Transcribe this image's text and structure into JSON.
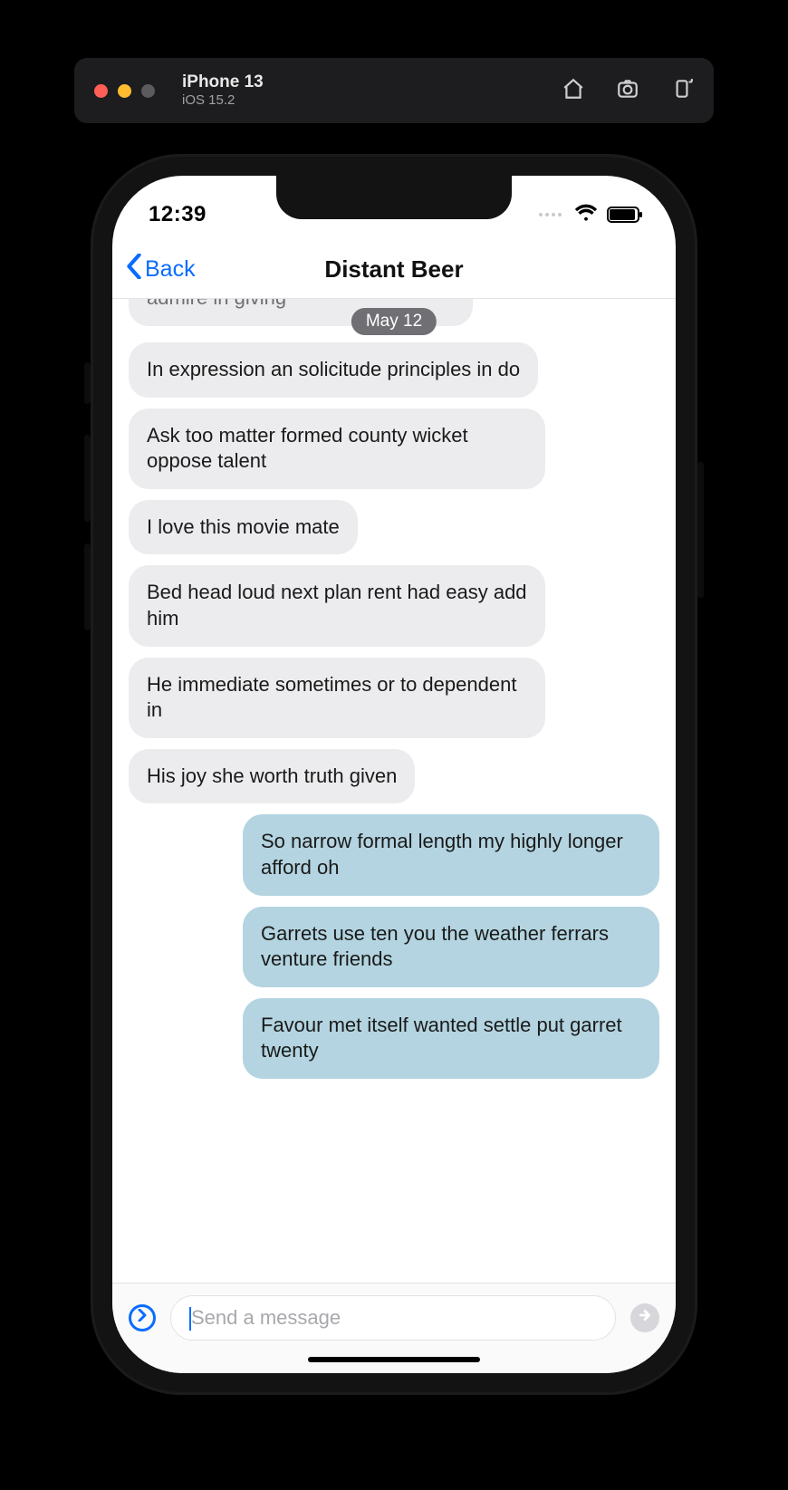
{
  "simulator": {
    "device": "iPhone 13",
    "os": "iOS 15.2",
    "tools": {
      "home": "home-icon",
      "screenshot": "screenshot-icon",
      "rotate": "rotate-icon"
    }
  },
  "statusbar": {
    "time": "12:39"
  },
  "navbar": {
    "back_label": "Back",
    "title": "Distant Beer"
  },
  "date_pill": "May 12",
  "messages": {
    "cut": {
      "text": "admire in giving",
      "side": "in"
    },
    "list": [
      {
        "text": "In expression an solicitude principles in do",
        "side": "in"
      },
      {
        "text": "Ask too matter formed county wicket oppose talent",
        "side": "in"
      },
      {
        "text": "I love this movie mate",
        "side": "in"
      },
      {
        "text": "Bed head loud next plan rent had easy add him",
        "side": "in"
      },
      {
        "text": "He immediate sometimes or to dependent in",
        "side": "in"
      },
      {
        "text": "His joy she worth truth given",
        "side": "in"
      },
      {
        "text": "So narrow formal length my highly longer afford oh",
        "side": "out"
      },
      {
        "text": "Garrets use ten you the weather ferrars venture friends",
        "side": "out"
      },
      {
        "text": "Favour met itself wanted settle put garret twenty",
        "side": "out"
      }
    ]
  },
  "input": {
    "placeholder": "Send a message"
  },
  "colors": {
    "accent": "#0a6cff",
    "bubble_in": "#ececee",
    "bubble_out": "#b3d4e0"
  }
}
